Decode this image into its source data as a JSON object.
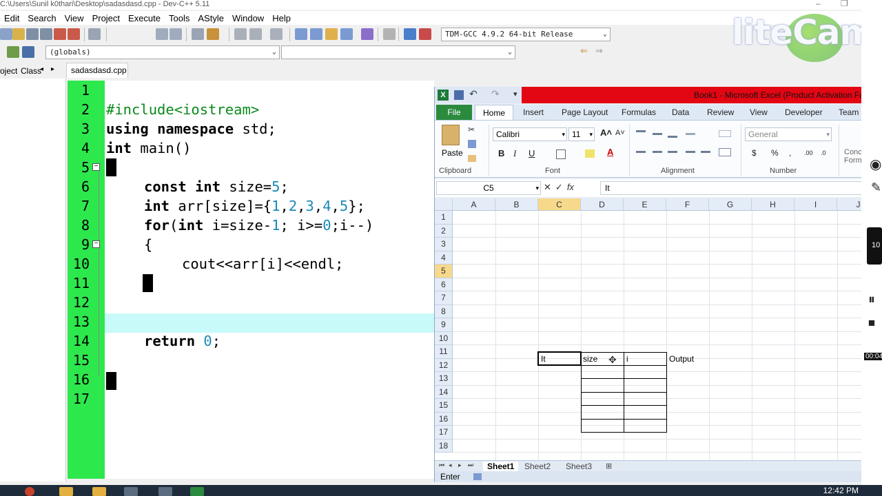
{
  "devcpp": {
    "title": "C:\\Users\\Sunil k0thari\\Desktop\\sadasdasd.cpp - Dev-C++ 5.11",
    "menu": [
      "Edit",
      "Search",
      "View",
      "Project",
      "Execute",
      "Tools",
      "AStyle",
      "Window",
      "Help"
    ],
    "compiler": "TDM-GCC 4.9.2 64-bit Release",
    "scope": "(globals)",
    "left_tabs": [
      "oject",
      "Class"
    ],
    "file_tab": "sadasdasd.cpp",
    "line_numbers": [
      "1",
      "2",
      "3",
      "4",
      "5",
      "6",
      "7",
      "8",
      "9",
      "10",
      "11",
      "12",
      "13",
      "14",
      "15",
      "16",
      "17"
    ],
    "code": {
      "l2": "#include<iostream>",
      "l3_kw1": "using",
      "l3_kw2": "namespace",
      "l3_rest": " std;",
      "l4_kw": "int",
      "l4_rest": " main()",
      "l6_kw1": "const",
      "l6_kw2": "int",
      "l6_rest": " size=",
      "l6_num": "5",
      "l6_end": ";",
      "l7_kw": "int",
      "l7_a": " arr[size]={",
      "l7_n1": "1",
      "l7_n2": "2",
      "l7_n3": "3",
      "l7_n4": "4",
      "l7_n5": "5",
      "l7_end": "};",
      "l8_kw1": "for",
      "l8_a": "(",
      "l8_kw2": "int",
      "l8_b": " i=size-",
      "l8_n1": "1",
      "l8_c": "; i>=",
      "l8_n2": "0",
      "l8_d": ";i--)",
      "l9": "{",
      "l10": "cout<<arr[i]<<endl;",
      "l14_kw": "return",
      "l14_sp": " ",
      "l14_num": "0",
      "l14_end": ";"
    }
  },
  "excel": {
    "title": "Book1 - Microsoft Excel (Product Activation Fa",
    "tabs": [
      "File",
      "Home",
      "Insert",
      "Page Layout",
      "Formulas",
      "Data",
      "Review",
      "View",
      "Developer",
      "Team"
    ],
    "font_name": "Calibri",
    "font_size": "11",
    "number_format": "General",
    "groups": [
      "Clipboard",
      "Font",
      "Alignment",
      "Number"
    ],
    "paste_label": "Paste",
    "styles_partial": [
      "Conc",
      "Form"
    ],
    "name_box": "C5",
    "formula": "It",
    "columns": [
      "A",
      "B",
      "C",
      "D",
      "E",
      "F",
      "G",
      "H",
      "I",
      "J"
    ],
    "rows": [
      "1",
      "2",
      "3",
      "4",
      "5",
      "6",
      "7",
      "8",
      "9",
      "10",
      "11",
      "12",
      "13",
      "14",
      "15",
      "16",
      "17",
      "18"
    ],
    "cells": {
      "C5": "It",
      "D5": "size",
      "E5": "i",
      "F5": "Output"
    },
    "sheets": [
      "Sheet1",
      "Sheet2",
      "Sheet3"
    ],
    "status": "Enter"
  },
  "overlay": {
    "watermark": "liteCam",
    "side_numbers": [
      "10",
      "00:04"
    ],
    "clock": "12:42 PM"
  }
}
